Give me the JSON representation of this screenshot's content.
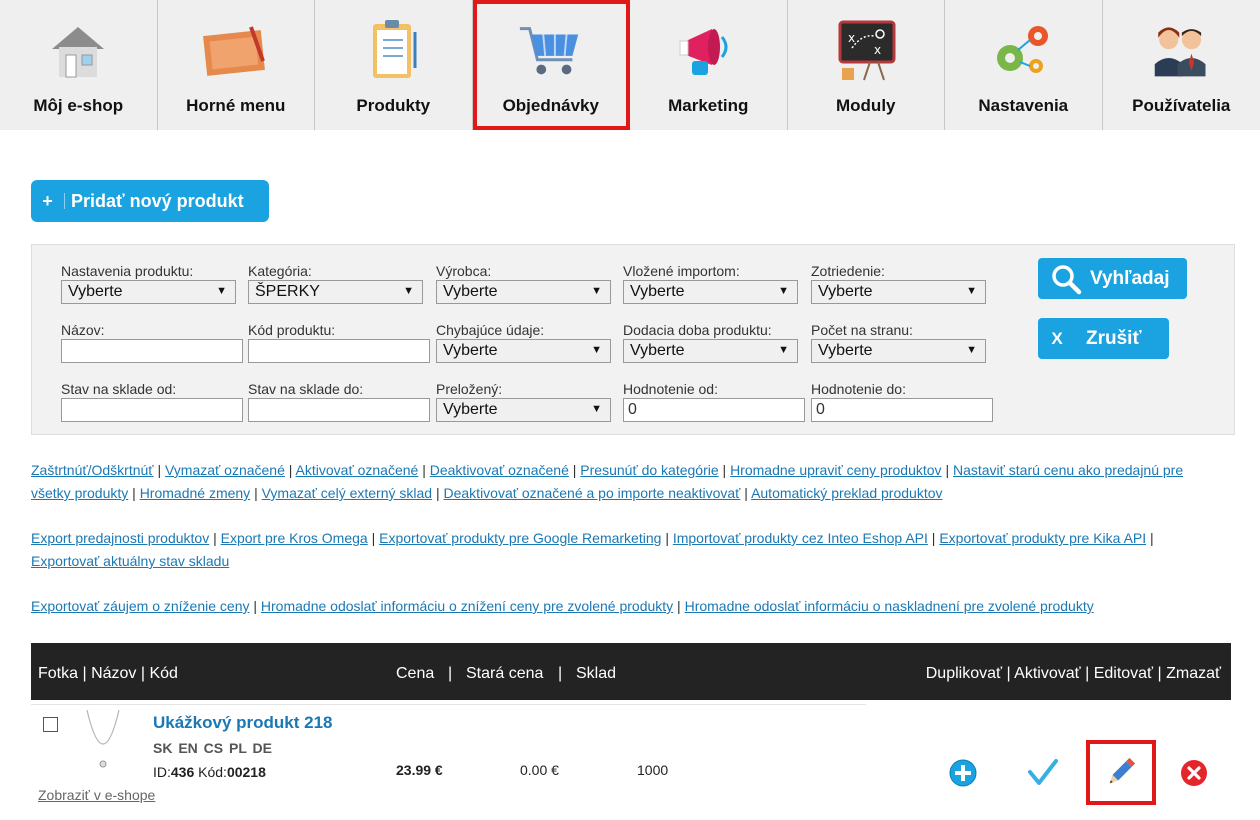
{
  "nav": {
    "tabs": [
      {
        "label": "Môj e-shop",
        "icon": "home-icon"
      },
      {
        "label": "Horné menu",
        "icon": "blueprint-icon"
      },
      {
        "label": "Produkty",
        "icon": "clipboard-icon"
      },
      {
        "label": "Objednávky",
        "icon": "cart-icon"
      },
      {
        "label": "Marketing",
        "icon": "megaphone-icon"
      },
      {
        "label": "Moduly",
        "icon": "strategy-board-icon"
      },
      {
        "label": "Nastavenia",
        "icon": "gears-icon"
      },
      {
        "label": "Používatelia",
        "icon": "users-icon"
      }
    ],
    "highlighted": "Objednávky"
  },
  "add_button": {
    "plus": "+",
    "label": "Pridať nový produkt"
  },
  "filters": {
    "nastavenia": {
      "label": "Nastavenia produktu:",
      "value": "Vyberte"
    },
    "kategoria": {
      "label": "Kategória:",
      "value": "ŠPERKY"
    },
    "vyrobca": {
      "label": "Výrobca:",
      "value": "Vyberte"
    },
    "importom": {
      "label": "Vložené importom:",
      "value": "Vyberte"
    },
    "zotriedenie": {
      "label": "Zotriedenie:",
      "value": "Vyberte"
    },
    "nazov": {
      "label": "Názov:",
      "value": ""
    },
    "kod": {
      "label": "Kód produktu:",
      "value": ""
    },
    "chybajuce": {
      "label": "Chybajúce údaje:",
      "value": "Vyberte"
    },
    "dodacia": {
      "label": "Dodacia doba produktu:",
      "value": "Vyberte"
    },
    "pocet": {
      "label": "Počet na stranu:",
      "value": "Vyberte"
    },
    "sklad_od": {
      "label": "Stav na sklade od:",
      "value": ""
    },
    "sklad_do": {
      "label": "Stav na sklade do:",
      "value": ""
    },
    "prelozeny": {
      "label": "Preložený:",
      "value": "Vyberte"
    },
    "hodn_od": {
      "label": "Hodnotenie od:",
      "value": "0"
    },
    "hodn_do": {
      "label": "Hodnotenie do:",
      "value": "0"
    },
    "search_label": "Vyhľadaj",
    "cancel_x": "X",
    "cancel_label": "Zrušiť"
  },
  "links": {
    "row1": [
      "Zaštrtnúť/Odškrtnúť",
      "Vymazať označené",
      "Aktivovať označené",
      "Deaktivovať označené",
      "Presunúť do kategórie",
      "Hromadne upraviť ceny produktov",
      "Nastaviť starú cenu ako predajnú pre"
    ],
    "row1b": [
      "všetky produkty",
      "Hromadné zmeny",
      "Vymazať celý externý sklad",
      "Deaktivovať označené a po importe neaktivovať",
      "Automatický preklad produktov"
    ],
    "row2": [
      "Export predajnosti produktov",
      "Export pre Kros Omega",
      "Exportovať produkty pre Google Remarketing",
      "Importovať produkty cez Inteo Eshop API",
      "Exportovať produkty pre Kika API"
    ],
    "row2b": [
      "Exportovať aktuálny stav skladu"
    ],
    "row3": [
      "Exportovať záujem o zníženie ceny",
      "Hromadne odoslať informáciu o znížení ceny pre zvolené produkty",
      "Hromadne odoslať informáciu o naskladnení pre zvolené produkty"
    ]
  },
  "table": {
    "h_left": "Fotka | Názov | Kód",
    "h_cena": "Cena",
    "h_sep": "|",
    "h_stara": "Stará cena",
    "h_sklad": "Sklad",
    "h_actions": "Duplikovať | Aktivovať | Editovať | Zmazať"
  },
  "product": {
    "name": "Ukážkový produkt 218",
    "langs": "SK EN CS PL DE",
    "id_label": "ID:",
    "id": "436",
    "kod_label": "Kód:",
    "kod": "00218",
    "view_link": "Zobraziť v e-shope",
    "price": "23.99 €",
    "old_price": "0.00 €",
    "stock": "1000"
  },
  "colors": {
    "accent": "#1aa3e0",
    "highlight": "#e01818",
    "link": "#1a79b5",
    "header_bg": "#232323"
  }
}
